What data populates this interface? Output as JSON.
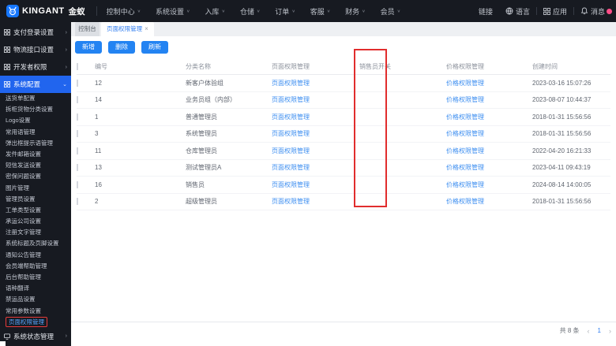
{
  "topbar": {
    "brand_name": "KINGANT",
    "brand_cn": "金蚁",
    "menus": [
      {
        "label": "控制中心"
      },
      {
        "label": "系统设置"
      },
      {
        "label": "入库"
      },
      {
        "label": "仓储"
      },
      {
        "label": "订单"
      },
      {
        "label": "客服"
      },
      {
        "label": "财务"
      },
      {
        "label": "会员"
      }
    ],
    "link_label": "链接",
    "language_label": "语言",
    "apps_label": "应用",
    "messages_label": "消息"
  },
  "sidebar": {
    "groups": [
      {
        "label": "支付登录设置"
      },
      {
        "label": "物流接口设置"
      },
      {
        "label": "开发者权限"
      },
      {
        "label": "系统配置"
      }
    ],
    "submenu": [
      "送货单配置",
      "拆柜货物分类设置",
      "Logo设置",
      "常用语管理",
      "弹出框提示语管理",
      "发件邮箱设置",
      "短信发送设置",
      "密保问题设置",
      "图片管理",
      "管理员设置",
      "工单类型设置",
      "承运公司设置",
      "注册文字管理",
      "系统标题及页脚设置",
      "通知公告管理",
      "会员端帮助管理",
      "后台帮助管理",
      "语种翻译",
      "禁运品设置",
      "常用参数设置",
      "页面权限管理"
    ],
    "selected_index": 20,
    "bottom_group": "系统状态管理"
  },
  "tabs": {
    "home_tab": "控制台",
    "active_tab": "页面权限管理",
    "close_glyph": "×"
  },
  "toolbar": {
    "buttons": [
      {
        "label": "新增"
      },
      {
        "label": "删除"
      },
      {
        "label": "刷新"
      }
    ]
  },
  "table": {
    "headers": [
      "编号",
      "分类名称",
      "页面权限管理",
      "销售员开关",
      "价格权限管理",
      "创建时间"
    ],
    "page_link_label": "页面权限管理",
    "price_link_label": "价格权限管理",
    "rows": [
      {
        "id": "12",
        "name": "新客户体验组",
        "switch_on": false,
        "created": "2023-03-16 15:07:26"
      },
      {
        "id": "14",
        "name": "业务员组（内部）",
        "switch_on": false,
        "created": "2023-08-07 10:44:37"
      },
      {
        "id": "1",
        "name": "普通管理员",
        "switch_on": false,
        "created": "2018-01-31 15:56:56"
      },
      {
        "id": "3",
        "name": "系统管理员",
        "switch_on": false,
        "created": "2018-01-31 15:56:56"
      },
      {
        "id": "11",
        "name": "仓库管理员",
        "switch_on": false,
        "created": "2022-04-20 16:21:33"
      },
      {
        "id": "13",
        "name": "测试管理员A",
        "switch_on": false,
        "created": "2023-04-11 09:43:19"
      },
      {
        "id": "16",
        "name": "销售员",
        "switch_on": true,
        "created": "2024-08-14 14:00:05"
      },
      {
        "id": "2",
        "name": "超级管理员",
        "switch_on": true,
        "created": "2018-01-31 15:56:56"
      }
    ]
  },
  "pagination": {
    "total_label": "共 8 条",
    "prev": "‹",
    "page": "1",
    "next": "›"
  },
  "colors": {
    "accent": "#2e7cf0",
    "switch_on": "#22c55e",
    "switch_off": "#f8504f",
    "annotation": "#e12d2d",
    "topbar_bg": "#171a21",
    "badge": "#ff4d88"
  }
}
